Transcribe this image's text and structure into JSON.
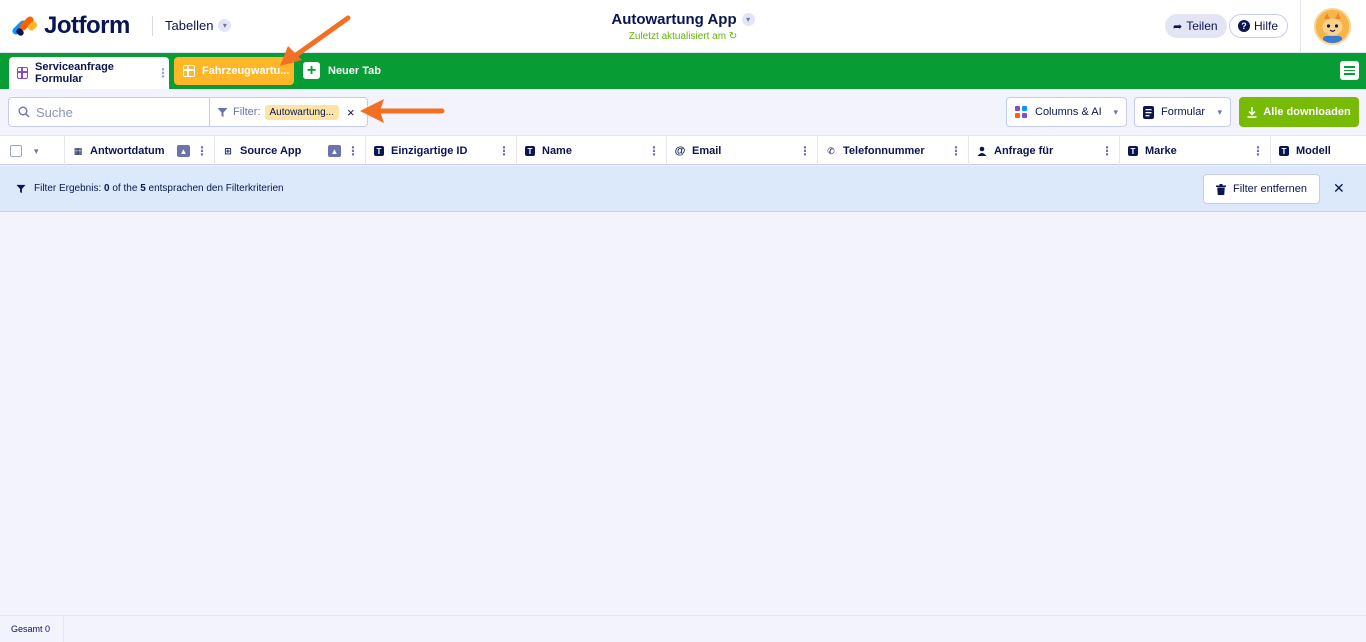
{
  "header": {
    "logo": "Jotform",
    "tables_menu": "Tabellen",
    "app_title": "Autowartung App",
    "last_updated": "Zuletzt aktualisiert am",
    "share_label": "Teilen",
    "help_label": "Hilfe"
  },
  "tabs": [
    {
      "label": "Serviceanfrage Formular"
    },
    {
      "label": "Fahrzeugwartu..."
    }
  ],
  "new_tab_label": "Neuer Tab",
  "toolbar": {
    "search_placeholder": "Suche",
    "filter_label": "Filter:",
    "filter_chip": "Autowartung...",
    "filter_clear": "×",
    "columns_label": "Columns & AI",
    "form_label": "Formular",
    "download_label": "Alle downloaden"
  },
  "columns": [
    {
      "label": "Antwortdatum",
      "icon": "calendar-icon"
    },
    {
      "label": "Source App",
      "icon": "grid-plus-icon"
    },
    {
      "label": "Einzigartige ID",
      "icon": "text-icon"
    },
    {
      "label": "Name",
      "icon": "text-icon"
    },
    {
      "label": "Email",
      "icon": "at-icon"
    },
    {
      "label": "Telefonnummer",
      "icon": "phone-icon"
    },
    {
      "label": "Anfrage für",
      "icon": "person-icon"
    },
    {
      "label": "Marke",
      "icon": "text-icon"
    },
    {
      "label": "Modell",
      "icon": "text-icon"
    }
  ],
  "filter_result": {
    "prefix": "Filter Ergebnis:",
    "count": "0",
    "of": "of the",
    "total": "5",
    "suffix": "entsprachen den Filterkriterien",
    "remove_label": "Filter entfernen"
  },
  "footer": {
    "total_label": "Gesamt 0"
  },
  "colors": {
    "tabbar": "#089c35",
    "active_tab": "#ffb629",
    "download": "#78bb07",
    "arrow": "#f36f21"
  }
}
